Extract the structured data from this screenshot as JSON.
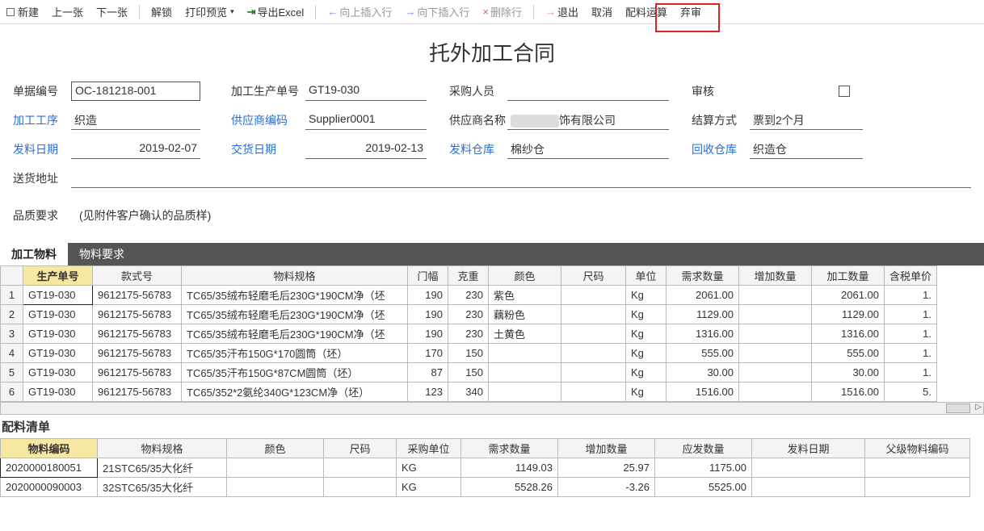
{
  "toolbar": {
    "new": "新建",
    "prev": "上一张",
    "next": "下一张",
    "unlock": "解锁",
    "print_preview": "打印预览",
    "export_excel": "导出Excel",
    "insert_up": "向上插入行",
    "insert_down": "向下插入行",
    "delete_row": "删除行",
    "exit": "退出",
    "cancel": "取消",
    "material_calc": "配料运算",
    "abandon": "弃审"
  },
  "title": "托外加工合同",
  "form": {
    "labels": {
      "doc_no": "单据编号",
      "prod_no": "加工生产单号",
      "buyer": "采购人员",
      "audit": "审核",
      "process": "加工工序",
      "supplier_code": "供应商编码",
      "supplier_name": "供应商名称",
      "settle": "结算方式",
      "send_date": "发料日期",
      "due_date": "交货日期",
      "send_wh": "发料仓库",
      "recv_wh": "回收仓库",
      "ship_addr": "送货地址",
      "quality": "品质要求"
    },
    "values": {
      "doc_no": "OC-181218-001",
      "prod_no": "GT19-030",
      "buyer": "",
      "process": "织造",
      "supplier_code": "Supplier0001",
      "supplier_name_suffix": "饰有限公司",
      "settle": "票到2个月",
      "send_date": "2019-02-07",
      "due_date": "2019-02-13",
      "send_wh": "棉纱仓",
      "recv_wh": "织造仓",
      "ship_addr": "",
      "quality": "(见附件客户确认的品质样)"
    }
  },
  "tabs1": {
    "a": "加工物料",
    "b": "物料要求"
  },
  "grid1": {
    "headers": [
      "",
      "生产单号",
      "款式号",
      "物料规格",
      "门幅",
      "克重",
      "颜色",
      "尺码",
      "单位",
      "需求数量",
      "增加数量",
      "加工数量",
      "含税单价"
    ],
    "rows": [
      {
        "n": "1",
        "prod": "GT19-030",
        "style": "9612175-56783",
        "spec": "TC65/35绒布轻磨毛后230G*190CM净（坯",
        "width": "190",
        "weight": "230",
        "color": "紫色",
        "size": "",
        "unit": "Kg",
        "req": "2061.00",
        "add": "",
        "work": "2061.00",
        "price": "1."
      },
      {
        "n": "2",
        "prod": "GT19-030",
        "style": "9612175-56783",
        "spec": "TC65/35绒布轻磨毛后230G*190CM净（坯",
        "width": "190",
        "weight": "230",
        "color": "藕粉色",
        "size": "",
        "unit": "Kg",
        "req": "1129.00",
        "add": "",
        "work": "1129.00",
        "price": "1."
      },
      {
        "n": "3",
        "prod": "GT19-030",
        "style": "9612175-56783",
        "spec": "TC65/35绒布轻磨毛后230G*190CM净（坯",
        "width": "190",
        "weight": "230",
        "color": "土黄色",
        "size": "",
        "unit": "Kg",
        "req": "1316.00",
        "add": "",
        "work": "1316.00",
        "price": "1."
      },
      {
        "n": "4",
        "prod": "GT19-030",
        "style": "9612175-56783",
        "spec": "TC65/35汗布150G*170圆筒（坯）",
        "width": "170",
        "weight": "150",
        "color": "",
        "size": "",
        "unit": "Kg",
        "req": "555.00",
        "add": "",
        "work": "555.00",
        "price": "1."
      },
      {
        "n": "5",
        "prod": "GT19-030",
        "style": "9612175-56783",
        "spec": "TC65/35汗布150G*87CM圆筒（坯）",
        "width": "87",
        "weight": "150",
        "color": "",
        "size": "",
        "unit": "Kg",
        "req": "30.00",
        "add": "",
        "work": "30.00",
        "price": "1."
      },
      {
        "n": "6",
        "prod": "GT19-030",
        "style": "9612175-56783",
        "spec": "TC65/352*2氨纶340G*123CM净（坯）",
        "width": "123",
        "weight": "340",
        "color": "",
        "size": "",
        "unit": "Kg",
        "req": "1516.00",
        "add": "",
        "work": "1516.00",
        "price": "5."
      }
    ]
  },
  "section2_title": "配料清单",
  "grid2": {
    "headers": [
      "物料编码",
      "物料规格",
      "颜色",
      "尺码",
      "采购单位",
      "需求数量",
      "增加数量",
      "应发数量",
      "发料日期",
      "父级物料编码"
    ],
    "rows": [
      {
        "code": "2020000180051",
        "spec": "21STC65/35大化纤",
        "color": "",
        "size": "",
        "unit": "KG",
        "req": "1149.03",
        "add": "25.97",
        "should": "1175.00",
        "date": "",
        "parent": ""
      },
      {
        "code": "2020000090003",
        "spec": "32STC65/35大化纤",
        "color": "",
        "size": "",
        "unit": "KG",
        "req": "5528.26",
        "add": "-3.26",
        "should": "5525.00",
        "date": "",
        "parent": ""
      }
    ]
  }
}
